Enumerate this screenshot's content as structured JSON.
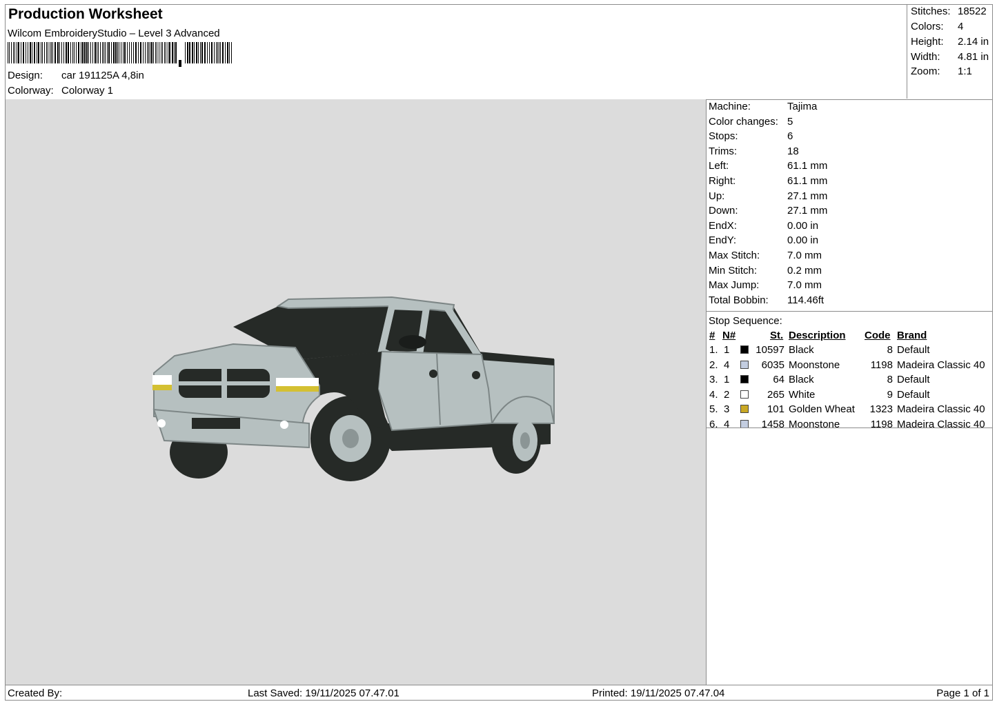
{
  "header": {
    "title": "Production Worksheet",
    "software": "Wilcom EmbroideryStudio – Level 3 Advanced",
    "design_label": "Design:",
    "design_value": "car 191125A 4,8in",
    "colorway_label": "Colorway:",
    "colorway_value": "Colorway 1"
  },
  "summary": [
    {
      "label": "Stitches:",
      "value": "18522"
    },
    {
      "label": "Colors:",
      "value": "4"
    },
    {
      "label": "Height:",
      "value": "2.14 in"
    },
    {
      "label": "Width:",
      "value": "4.81 in"
    },
    {
      "label": "Zoom:",
      "value": "1:1"
    }
  ],
  "machine_info": [
    {
      "label": "Machine:",
      "value": "Tajima"
    },
    {
      "label": "Color changes:",
      "value": "5"
    },
    {
      "label": "Stops:",
      "value": "6"
    },
    {
      "label": "Trims:",
      "value": "18"
    },
    {
      "label": "Left:",
      "value": "61.1 mm"
    },
    {
      "label": "Right:",
      "value": "61.1 mm"
    },
    {
      "label": "Up:",
      "value": "27.1 mm"
    },
    {
      "label": "Down:",
      "value": "27.1 mm"
    },
    {
      "label": "EndX:",
      "value": "0.00 in"
    },
    {
      "label": "EndY:",
      "value": "0.00 in"
    },
    {
      "label": "Max Stitch:",
      "value": "7.0 mm"
    },
    {
      "label": "Min Stitch:",
      "value": "0.2 mm"
    },
    {
      "label": "Max Jump:",
      "value": "7.0 mm"
    },
    {
      "label": "Total Bobbin:",
      "value": "114.46ft"
    }
  ],
  "stop_sequence": {
    "title": "Stop Sequence:",
    "columns": {
      "num": "#",
      "needle": "N#",
      "stitches": "St.",
      "description": "Description",
      "code": "Code",
      "brand": "Brand"
    },
    "rows": [
      {
        "num": "1.",
        "needle": "1",
        "color": "#000000",
        "stitches": "10597",
        "description": "Black",
        "code": "8",
        "brand": "Default"
      },
      {
        "num": "2.",
        "needle": "4",
        "color": "#c3cde0",
        "stitches": "6035",
        "description": "Moonstone",
        "code": "1198",
        "brand": "Madeira Classic 40"
      },
      {
        "num": "3.",
        "needle": "1",
        "color": "#000000",
        "stitches": "64",
        "description": "Black",
        "code": "8",
        "brand": "Default"
      },
      {
        "num": "4.",
        "needle": "2",
        "color": "#ffffff",
        "stitches": "265",
        "description": "White",
        "code": "9",
        "brand": "Default"
      },
      {
        "num": "5.",
        "needle": "3",
        "color": "#c9a824",
        "stitches": "101",
        "description": "Golden Wheat",
        "code": "1323",
        "brand": "Madeira Classic 40"
      },
      {
        "num": "6.",
        "needle": "4",
        "color": "#c3cde0",
        "stitches": "1458",
        "description": "Moonstone",
        "code": "1198",
        "brand": "Madeira Classic 40"
      }
    ]
  },
  "footer": {
    "created_by": "Created By:",
    "last_saved": "Last Saved: 19/11/2025 07.47.01",
    "printed": "Printed: 19/11/2025 07.47.04",
    "page": "Page 1 of 1"
  },
  "colors": {
    "canvas_bg": "#dcdcdc",
    "body_light": "#b6c0c0",
    "body_dark": "#262a27",
    "headlight_yellow": "#d4c032"
  }
}
